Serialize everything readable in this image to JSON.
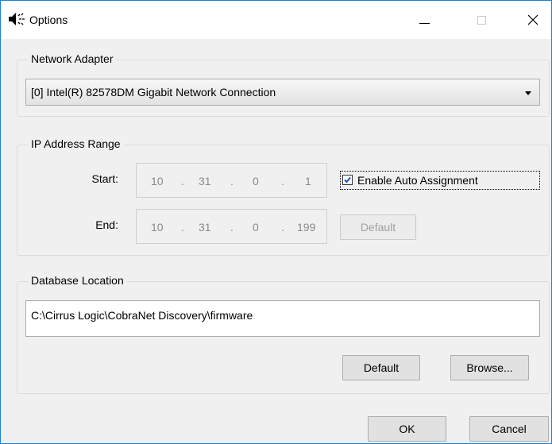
{
  "window": {
    "title": "Options",
    "icon": "speaker-icon",
    "controls": {
      "minimize": "minimize-icon",
      "maximize": "maximize-icon",
      "close": "close-icon"
    }
  },
  "network_adapter": {
    "label": "Network Adapter",
    "selected": "[0] Intel(R) 82578DM Gigabit Network Connection"
  },
  "ip_range": {
    "label": "IP Address Range",
    "start": {
      "label": "Start:",
      "octets": [
        "10",
        "31",
        "0",
        "1"
      ]
    },
    "end": {
      "label": "End:",
      "octets": [
        "10",
        "31",
        "0",
        "199"
      ]
    },
    "dot": ".",
    "auto_assign": {
      "label": "Enable Auto Assignment",
      "checked": true
    },
    "default_label": "Default"
  },
  "database": {
    "label": "Database Location",
    "path": "C:\\Cirrus Logic\\CobraNet Discovery\\firmware",
    "default_label": "Default",
    "browse_label": "Browse..."
  },
  "footer": {
    "ok_label": "OK",
    "cancel_label": "Cancel"
  }
}
